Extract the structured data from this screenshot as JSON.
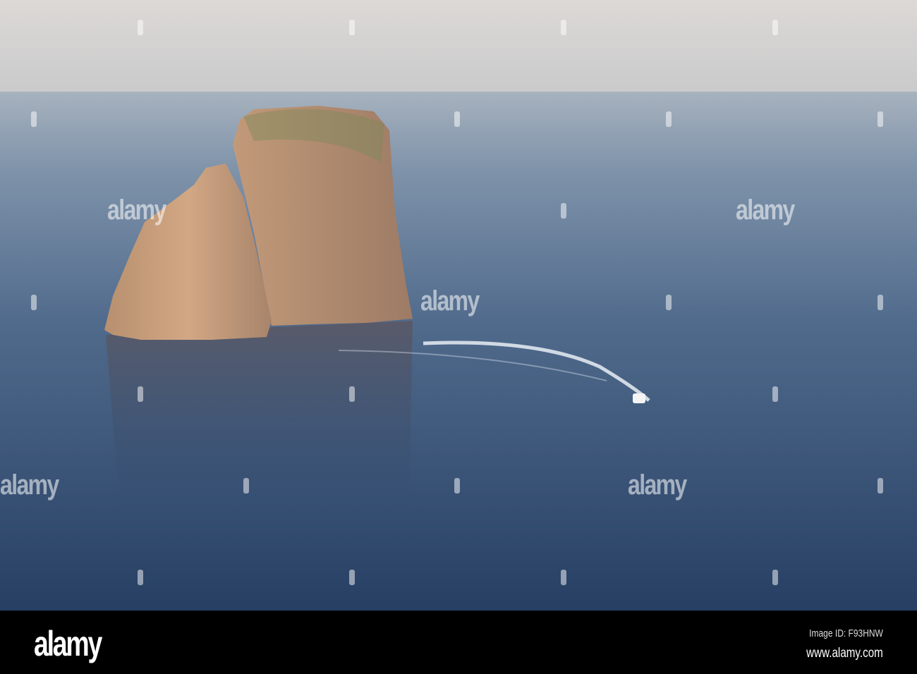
{
  "photo": {
    "subject": "sea stacks and speedboat",
    "colors": {
      "sky": "#d9d6d3",
      "horizon": "#a9b3bd",
      "sea_deep": "#2c4468",
      "rock": "#c79a78"
    }
  },
  "watermark": {
    "text": "alamy"
  },
  "footer": {
    "logo": "alamy",
    "image_id": "Image ID: F93HNW",
    "website": "www.alamy.com"
  }
}
